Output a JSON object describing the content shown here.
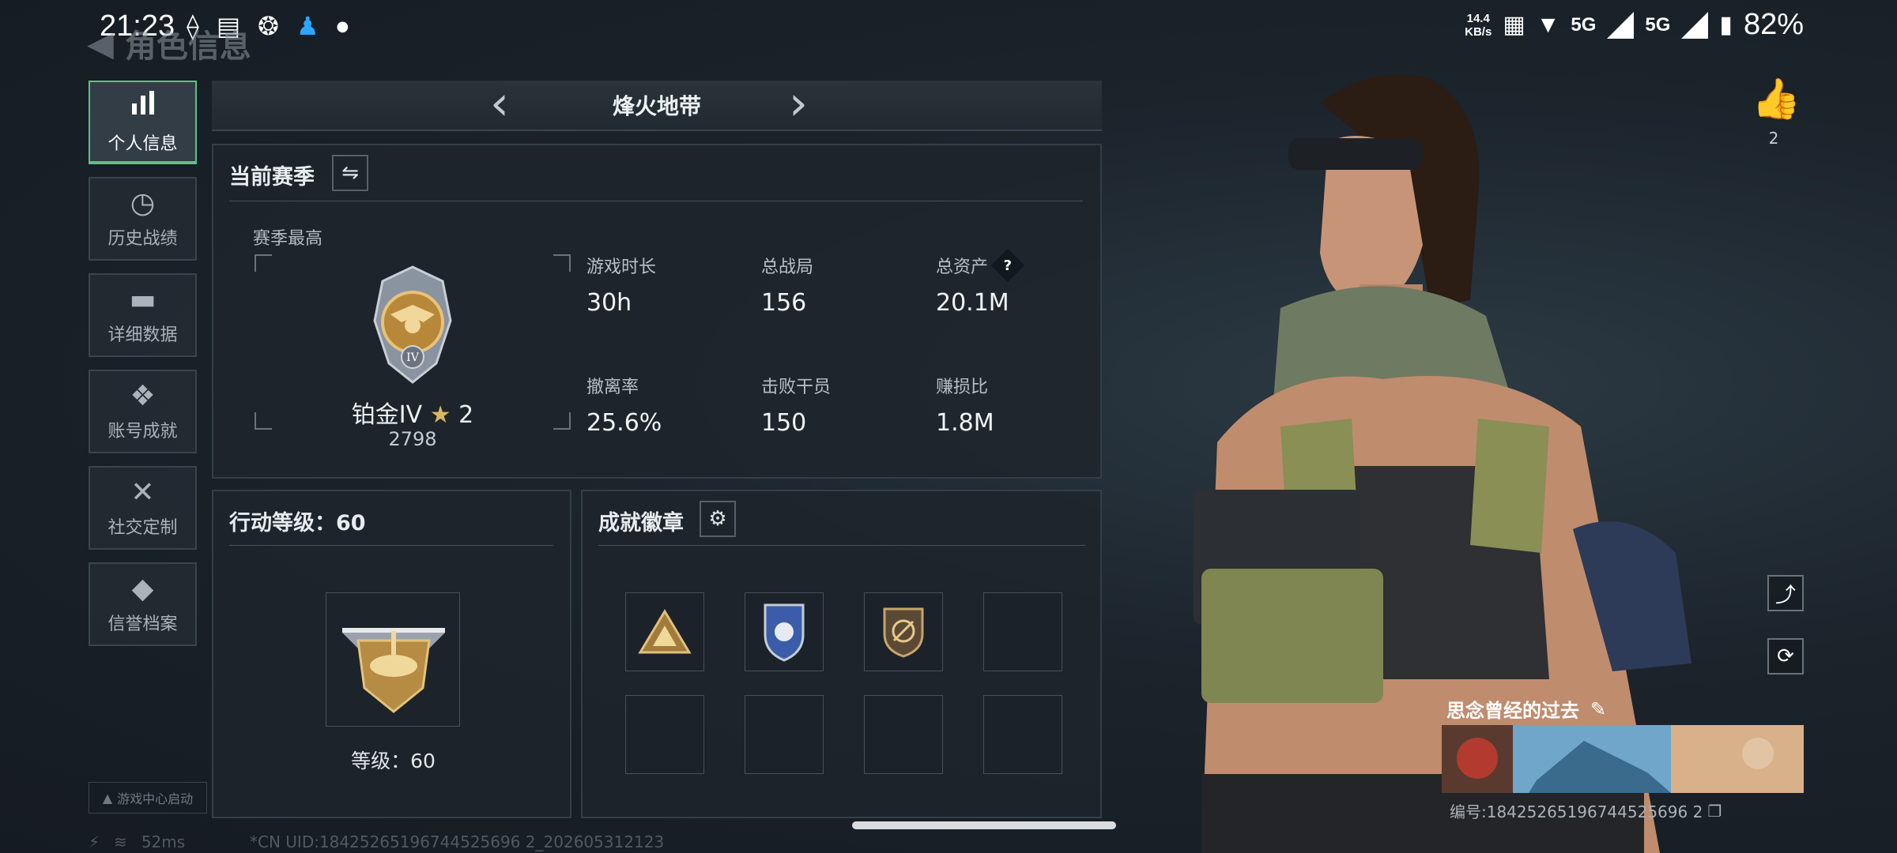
{
  "status_bar": {
    "time": "21:23",
    "net_speed_value": "14.4",
    "net_speed_unit": "KB/s",
    "signal_1": "5G",
    "signal_2": "5G",
    "battery": "82%"
  },
  "header": {
    "back_title": "角色信息"
  },
  "sidebar": {
    "items": [
      {
        "label": "个人信息",
        "icon": "bar-chart-icon",
        "active": true
      },
      {
        "label": "历史战绩",
        "icon": "history-icon",
        "active": false
      },
      {
        "label": "详细数据",
        "icon": "folder-icon",
        "active": false
      },
      {
        "label": "账号成就",
        "icon": "achievement-icon",
        "active": false
      },
      {
        "label": "社交定制",
        "icon": "tools-icon",
        "active": false
      },
      {
        "label": "信誉档案",
        "icon": "credit-icon",
        "active": false
      }
    ],
    "launch_tag": "游戏中心启动"
  },
  "mode_bar": {
    "title": "烽火地带"
  },
  "season": {
    "title": "当前赛季",
    "best_label": "赛季最高",
    "rank_name": "铂金IV",
    "rank_stars": "2",
    "rank_score": "2798",
    "stats": [
      {
        "label": "游戏时长",
        "value": "30h"
      },
      {
        "label": "总战局",
        "value": "156"
      },
      {
        "label": "总资产",
        "value": "20.1M",
        "help": true
      },
      {
        "label": "撤离率",
        "value": "25.6%"
      },
      {
        "label": "击败干员",
        "value": "150"
      },
      {
        "label": "赚损比",
        "value": "1.8M"
      }
    ]
  },
  "action_level": {
    "title": "行动等级：60",
    "level_text": "等级：60"
  },
  "badges": {
    "title": "成就徽章"
  },
  "footer": {
    "ping": "52ms",
    "uid": "*CN UID:18425265196744525696 2_202605312123"
  },
  "character": {
    "likes": "2",
    "motto": "思念曾经的过去",
    "serial": "编号:18425265196744525696 2"
  },
  "colors": {
    "accent": "#5bc28a",
    "background": "#1a2027",
    "panel_border": "#343e48"
  }
}
